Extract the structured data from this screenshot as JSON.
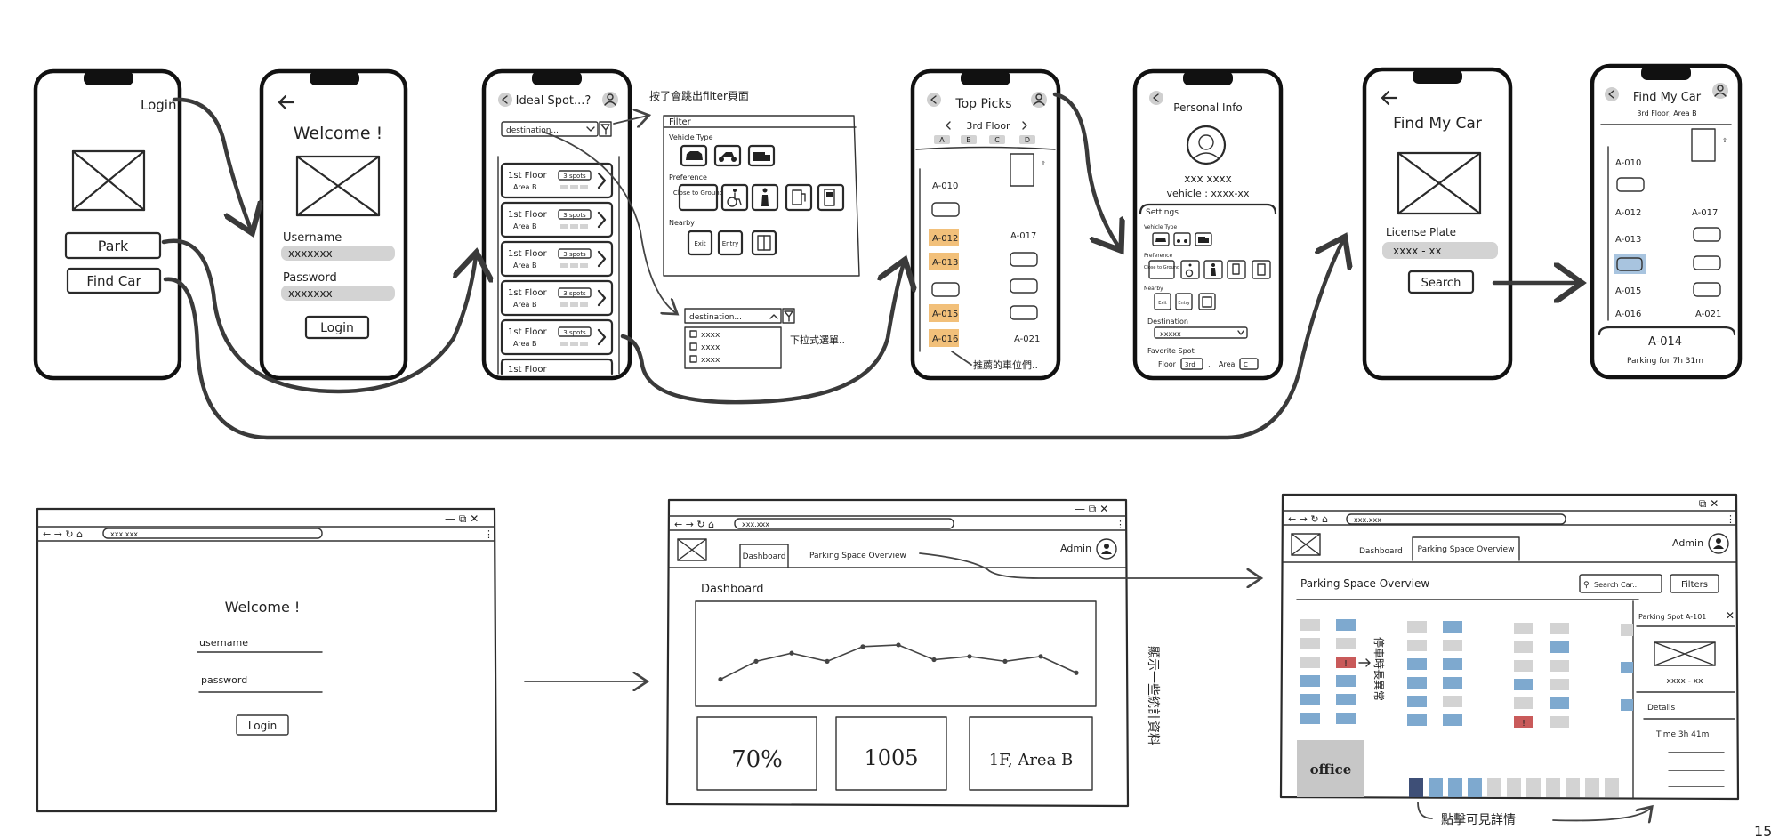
{
  "phone1": {
    "login_link": "Login",
    "park_button": "Park",
    "find_car_button": "Find Car"
  },
  "phone2": {
    "welcome": "Welcome !",
    "username_label": "Username",
    "username_value": "xxxxxxx",
    "password_label": "Password",
    "password_value": "xxxxxxx",
    "login_button": "Login"
  },
  "phone3": {
    "title": "Ideal Spot...?",
    "destination_placeholder": "destination...",
    "spots": [
      {
        "floor": "1st Floor",
        "area": "Area B",
        "count": "3 spots"
      },
      {
        "floor": "1st Floor",
        "area": "Area B",
        "count": "3 spots"
      },
      {
        "floor": "1st Floor",
        "area": "Area B",
        "count": "3 spots"
      },
      {
        "floor": "1st Floor",
        "area": "Area B",
        "count": "3 spots"
      },
      {
        "floor": "1st Floor",
        "area": "Area B",
        "count": "3 spots"
      },
      {
        "floor": "1st Floor"
      }
    ],
    "note_filter": "按了會跳出filter頁面",
    "note_dropdown": "下拉式選單.."
  },
  "filter_panel": {
    "title": "Filter",
    "vehicle_type": "Vehicle Type",
    "preference": "Preference",
    "close_to_ground": "Close to Ground",
    "nearby": "Nearby",
    "exit": "Exit",
    "entry": "Entry"
  },
  "dropdown": {
    "placeholder": "destination...",
    "options": [
      "xxxx",
      "xxxx",
      "xxxx"
    ]
  },
  "phone4": {
    "title": "Top Picks",
    "floor": "3rd Floor",
    "areas": [
      "A",
      "B",
      "C",
      "D"
    ],
    "left_spots": [
      "A-010",
      "A-012",
      "A-013",
      "A-015",
      "A-016"
    ],
    "right_spots": [
      "A-017",
      "A-021"
    ],
    "note": "推薦的車位們.."
  },
  "phone5": {
    "title": "Personal Info",
    "name": "xxx xxxx",
    "vehicle": "vehicle : xxxx-xx",
    "settings": "Settings",
    "vehicle_type": "Vehicle Type",
    "preference": "Preference",
    "close_to_ground": "Close to Ground",
    "nearby": "Nearby",
    "exit": "Exit",
    "entry": "Entry",
    "destination": "Destination",
    "destination_value": "xxxxx",
    "favorite_spot": "Favorite Spot",
    "floor_label": "Floor",
    "floor_value": "3rd",
    "area_label": "Area",
    "area_value": "C"
  },
  "phone6": {
    "title": "Find My Car",
    "plate_label": "License Plate",
    "plate_value": "xxxx - xx",
    "search_button": "Search"
  },
  "phone7": {
    "title": "Find My Car",
    "subtitle": "3rd Floor, Area B",
    "left_spots": [
      "A-010",
      "A-012",
      "A-013",
      "A-015",
      "A-016"
    ],
    "right_spots": [
      "A-017",
      "A-021"
    ],
    "result_spot": "A-014",
    "parking_time": "Parking for  7h 31m"
  },
  "browser1": {
    "url": "xxx.xxx",
    "welcome": "Welcome !",
    "username_label": "username",
    "password_label": "password",
    "login_button": "Login"
  },
  "browser2": {
    "url": "xxx.xxx",
    "tab_dashboard": "Dashboard",
    "tab_overview": "Parking Space Overview",
    "admin": "Admin",
    "section_title": "Dashboard",
    "stats": [
      "70%",
      "1005",
      "1F, Area B"
    ],
    "note": "顯示一些統計資料"
  },
  "browser3": {
    "url": "xxx.xxx",
    "tab_dashboard": "Dashboard",
    "tab_overview": "Parking Space Overview",
    "admin": "Admin",
    "section_title": "Parking Space Overview",
    "search_placeholder": "Search Car...",
    "filters_button": "Filters",
    "office": "office",
    "note_long_stay": "停車時長異常",
    "note_click": "點擊可見詳情",
    "detail": {
      "title": "Parking Spot A-101",
      "plate": "xxxx - xx",
      "details": "Details",
      "time": "Time  3h 41m"
    }
  },
  "page_number": "15",
  "chart_data": {
    "type": "line",
    "x": [
      1,
      2,
      3,
      4,
      5,
      6,
      7,
      8,
      9,
      10,
      11
    ],
    "y": [
      20,
      42,
      52,
      42,
      60,
      62,
      44,
      48,
      42,
      48,
      28
    ],
    "ylim": [
      0,
      100
    ],
    "grid": false
  }
}
